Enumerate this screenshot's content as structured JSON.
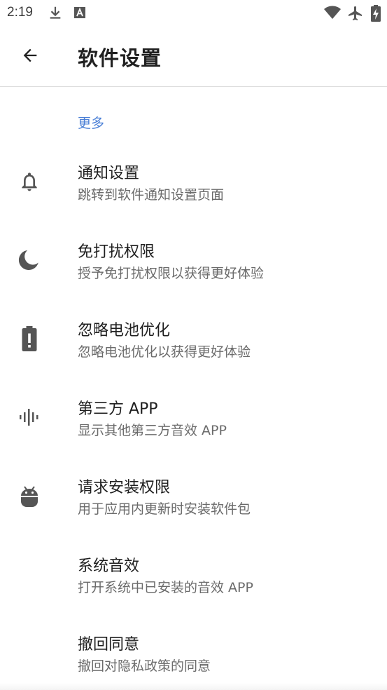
{
  "status_bar": {
    "time": "2:19",
    "left_icons": [
      "download-icon",
      "a-box-icon"
    ],
    "right_icons": [
      "wifi-icon",
      "airplane-icon",
      "battery-charging-icon"
    ]
  },
  "app_bar": {
    "back_icon": "arrow-back-icon",
    "title": "软件设置"
  },
  "section": {
    "header": "更多",
    "accent_color": "#4a7fd6"
  },
  "items": [
    {
      "title": "通知设置",
      "summary": "跳转到软件通知设置页面",
      "icon": "bell-icon"
    },
    {
      "title": "免打扰权限",
      "summary": "授予免打扰权限以获得更好体验",
      "icon": "moon-icon"
    },
    {
      "title": "忽略电池优化",
      "summary": "忽略电池优化以获得更好体验",
      "icon": "battery-alert-icon"
    },
    {
      "title": "第三方 APP",
      "summary": "显示其他第三方音效 APP",
      "icon": "waveform-icon"
    },
    {
      "title": "请求安装权限",
      "summary": "用于应用内更新时安装软件包",
      "icon": "android-icon"
    },
    {
      "title": "系统音效",
      "summary": "打开系统中已安装的音效 APP",
      "icon": ""
    },
    {
      "title": "撤回同意",
      "summary": "撤回对隐私政策的同意",
      "icon": ""
    }
  ]
}
